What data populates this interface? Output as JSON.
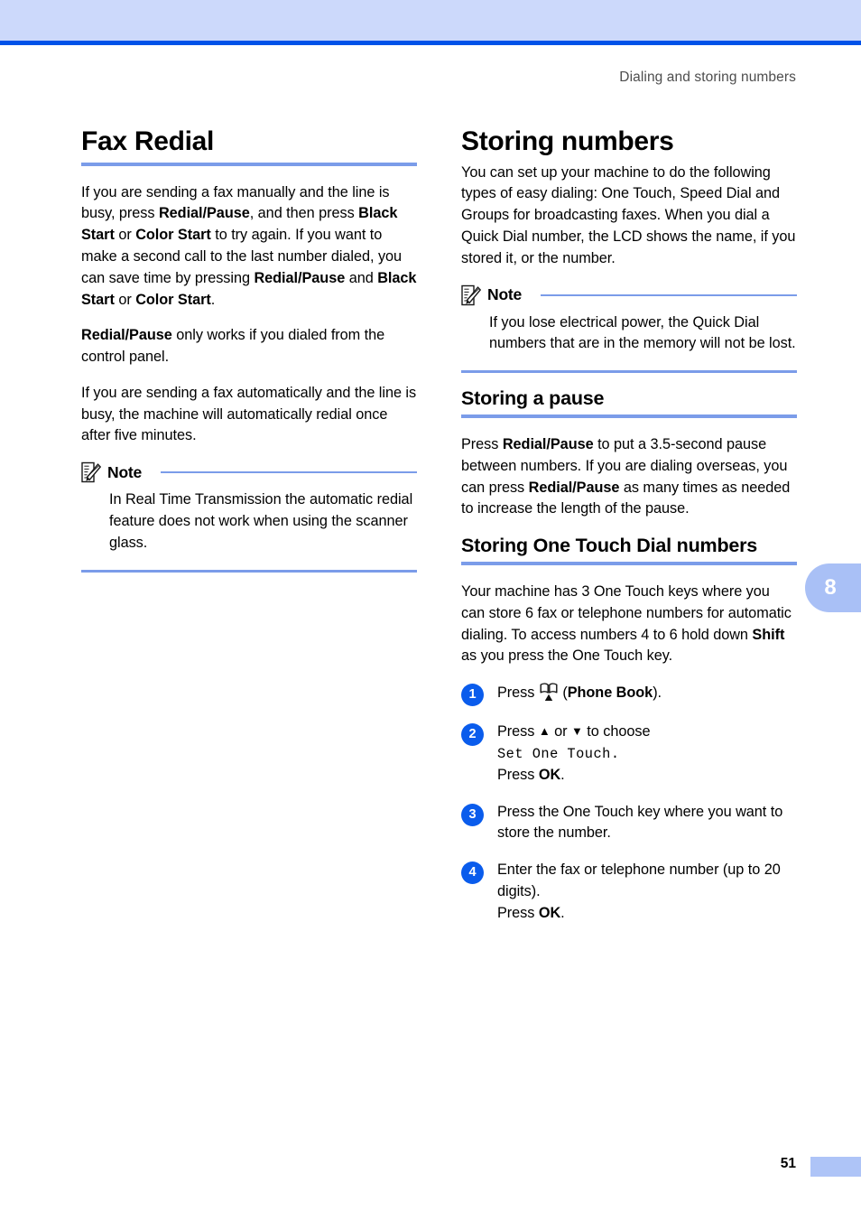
{
  "header": {
    "running_title": "Dialing and storing numbers"
  },
  "chapter_tab": {
    "number": "8"
  },
  "footer": {
    "page_number": "51"
  },
  "left_column": {
    "heading": "Fax Redial",
    "paragraph_1": {
      "parts": [
        {
          "text": "If you are sending a fax manually and the line is busy, press ",
          "bold": false
        },
        {
          "text": "Redial/Pause",
          "bold": true
        },
        {
          "text": ", and then press ",
          "bold": false
        },
        {
          "text": "Black Start",
          "bold": true
        },
        {
          "text": " or ",
          "bold": false
        },
        {
          "text": "Color Start",
          "bold": true
        },
        {
          "text": " to try again. If you want to make a second call to the last number dialed, you can save time by pressing ",
          "bold": false
        },
        {
          "text": "Redial/Pause",
          "bold": true
        },
        {
          "text": " and ",
          "bold": false
        },
        {
          "text": "Black Start",
          "bold": true
        },
        {
          "text": " or ",
          "bold": false
        },
        {
          "text": "Color Start",
          "bold": true
        },
        {
          "text": ".",
          "bold": false
        }
      ]
    },
    "paragraph_2": {
      "parts": [
        {
          "text": "Redial/Pause",
          "bold": true
        },
        {
          "text": " only works if you dialed from the control panel.",
          "bold": false
        }
      ]
    },
    "paragraph_3": {
      "parts": [
        {
          "text": "If you are sending a fax automatically and the line is busy, the machine will automatically redial once after five minutes.",
          "bold": false
        }
      ]
    },
    "note": {
      "label": "Note",
      "icon": "note-pencil-icon",
      "body": "In Real Time Transmission the automatic redial feature does not work when using the scanner glass."
    }
  },
  "right_column": {
    "heading": "Storing numbers",
    "intro": "You can set up your machine to do the following types of easy dialing: One Touch, Speed Dial and Groups for broadcasting faxes. When you dial a Quick Dial number, the LCD shows the name, if you stored it, or the number.",
    "note": {
      "label": "Note",
      "icon": "note-pencil-icon",
      "body": "If you lose electrical power, the Quick Dial numbers that are in the memory will not be lost."
    },
    "storing_pause": {
      "heading": "Storing a pause",
      "paragraph": {
        "parts": [
          {
            "text": "Press ",
            "bold": false
          },
          {
            "text": "Redial/Pause",
            "bold": true
          },
          {
            "text": " to put a 3.5-second pause between numbers. If you are dialing overseas, you can press ",
            "bold": false
          },
          {
            "text": "Redial/Pause",
            "bold": true
          },
          {
            "text": " as many times as needed to increase the length of the pause.",
            "bold": false
          }
        ]
      }
    },
    "storing_one_touch": {
      "heading": "Storing One Touch Dial numbers",
      "paragraph": {
        "parts": [
          {
            "text": "Your machine has 3 One Touch keys where you can store 6 fax or telephone numbers for automatic dialing. To access numbers 4 to 6 hold down ",
            "bold": false
          },
          {
            "text": "Shift",
            "bold": true
          },
          {
            "text": " as you press the One Touch key.",
            "bold": false
          }
        ]
      },
      "steps": [
        {
          "number": "1",
          "parts": [
            {
              "text": "Press ",
              "bold": false
            },
            {
              "icon": "phone-book-icon"
            },
            {
              "text": " (",
              "bold": false
            },
            {
              "text": "Phone Book",
              "bold": true
            },
            {
              "text": ").",
              "bold": false
            }
          ]
        },
        {
          "number": "2",
          "parts": [
            {
              "text": "Press ",
              "bold": false
            },
            {
              "text": "▲",
              "bold": false,
              "glyph": true
            },
            {
              "text": " or ",
              "bold": false
            },
            {
              "text": "▼",
              "bold": false,
              "glyph": true
            },
            {
              "text": " to choose",
              "bold": false
            },
            {
              "break": true
            },
            {
              "text": "Set One Touch.",
              "lcd": true
            },
            {
              "break": true
            },
            {
              "text": "Press ",
              "bold": false
            },
            {
              "text": "OK",
              "bold": true
            },
            {
              "text": ".",
              "bold": false
            }
          ]
        },
        {
          "number": "3",
          "parts": [
            {
              "text": "Press the One Touch key where you want to store the number.",
              "bold": false
            }
          ]
        },
        {
          "number": "4",
          "parts": [
            {
              "text": "Enter the fax or telephone number (up to 20 digits).",
              "bold": false
            },
            {
              "break": true
            },
            {
              "text": "Press ",
              "bold": false
            },
            {
              "text": "OK",
              "bold": true
            },
            {
              "text": ".",
              "bold": false
            }
          ]
        }
      ]
    }
  },
  "colors": {
    "band_light_blue": "#ccd9fb",
    "rule_strong_blue": "#0052e8",
    "rule_medium_blue": "#7b9ce9",
    "step_circle_blue": "#0a5cec",
    "tab_blue": "#a9c0f6",
    "header_text_gray": "#4d4d4d"
  }
}
